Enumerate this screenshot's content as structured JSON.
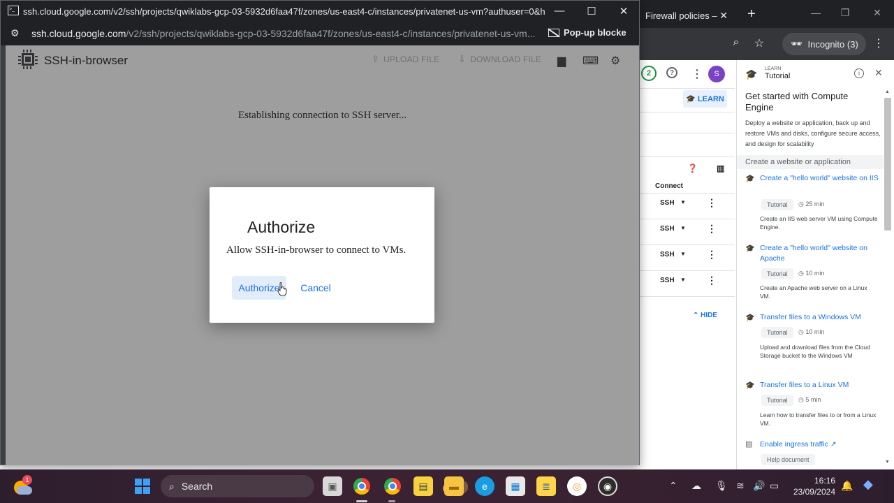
{
  "background_browser": {
    "tab_title": "Firewall policies – ",
    "incognito_label": "Incognito (3)"
  },
  "console": {
    "notification_count": "2",
    "avatar_letter": "S",
    "learn_label": "LEARN",
    "connect_header": "Connect",
    "ssh_rows": [
      "SSH",
      "SSH",
      "SSH",
      "SSH"
    ],
    "hide_label": "HIDE"
  },
  "tutorial_panel": {
    "eyebrow": "LEARN",
    "header": "Tutorial",
    "title": "Get started with Compute Engine",
    "description": "Deploy a website or application, back up and restore VMs and disks, configure secure access, and design for scalability",
    "section": "Create a website or application",
    "items": [
      {
        "title": "Create a \"hello world\" website on IIS",
        "type": "Tutorial",
        "duration": "25 min",
        "description": "Create an IIS web server VM using Compute Engine."
      },
      {
        "title": "Create a \"hello world\" website on Apache",
        "type": "Tutorial",
        "duration": "10 min",
        "description": "Create an Apache web server on a Linux VM."
      },
      {
        "title": "Transfer files to a Windows VM",
        "type": "Tutorial",
        "duration": "10 min",
        "description": "Upload and download files from the Cloud Storage bucket to the Windows VM"
      },
      {
        "title": "Transfer files to a Linux VM",
        "type": "Tutorial",
        "duration": "5 min",
        "description": "Learn how to transfer files to or from a Linux VM."
      }
    ],
    "doc_link": "Enable ingress traffic",
    "doc_type": "Help document"
  },
  "popup_window": {
    "title": "ssh.cloud.google.com/v2/ssh/projects/qwiklabs-gcp-03-5932d6faa47f/zones/us-east4-c/instances/privatenet-us-vm?authuser=0&hl=en_U...",
    "url_host": "ssh.cloud.google.com",
    "url_path": "/v2/ssh/projects/qwiklabs-gcp-03-5932d6faa47f/zones/us-east4-c/instances/privatenet-us-vm...",
    "popup_blocked": "Pop-up blocke"
  },
  "ssh_page": {
    "title": "SSH-in-browser",
    "upload_label": "UPLOAD FILE",
    "download_label": "DOWNLOAD FILE",
    "status_message": "Establishing connection to SSH server..."
  },
  "dialog": {
    "title": "Authorize",
    "body": "Allow SSH-in-browser to connect to VMs.",
    "authorize_label": "Authorize",
    "cancel_label": "Cancel"
  },
  "taskbar": {
    "weather_badge": "1",
    "search_label": "Search",
    "time": "16:16",
    "date": "23/09/2024"
  },
  "colors": {
    "accent": "#1a73e8",
    "dialog_primary_bg": "#e3edf9",
    "ssh_overlay": "#9e9e9e"
  }
}
